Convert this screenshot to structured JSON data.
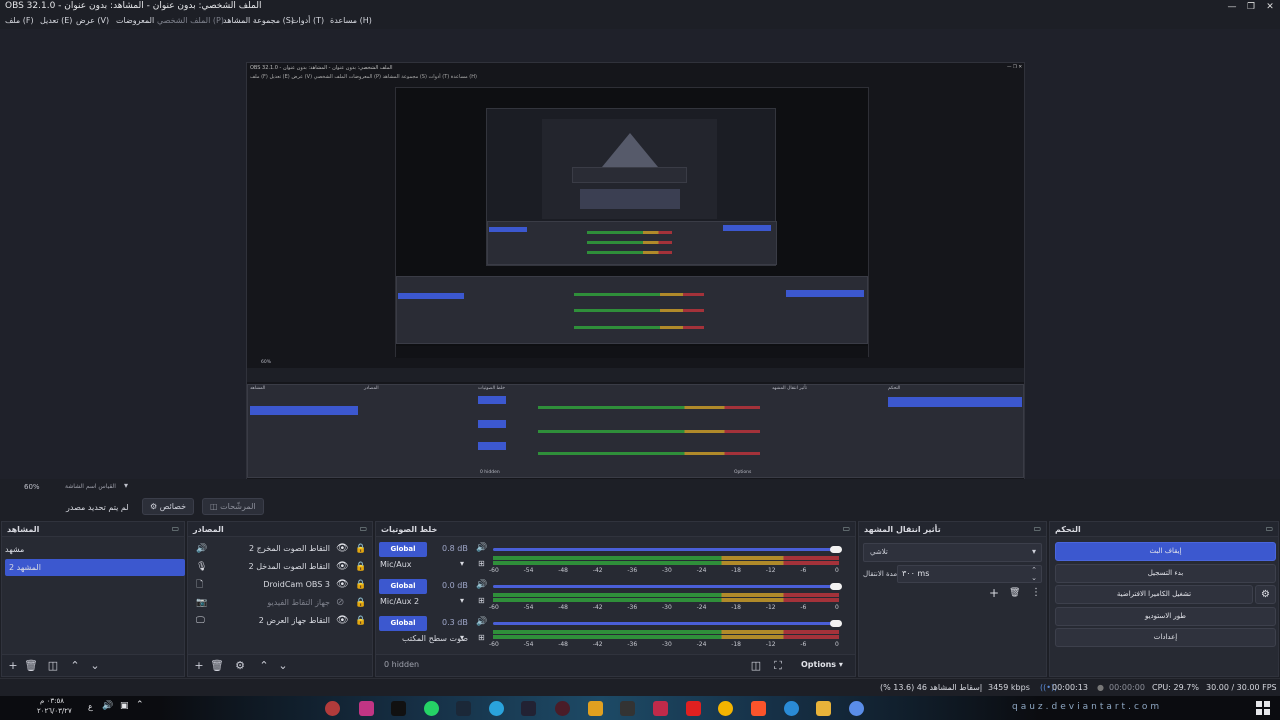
{
  "window": {
    "title": "OBS 32.1.0 - الملف الشخصي: بدون عنوان - المشاهد: بدون عنوان",
    "minimize": "—",
    "maximize": "❐",
    "close": "✕"
  },
  "menu": [
    {
      "label": "ملف (F)",
      "key": "file"
    },
    {
      "label": "تعديل (E)",
      "key": "edit"
    },
    {
      "label": "عرض (V)",
      "key": "view"
    },
    {
      "label": "المعروضات",
      "key": "docks"
    },
    {
      "label": "الملف الشخصي (P)",
      "key": "profile"
    },
    {
      "label": "مجموعة المشاهد (S)",
      "key": "scenes"
    },
    {
      "label": "أدوات (T)",
      "key": "tools"
    },
    {
      "label": "مساعدة (H)",
      "key": "help"
    }
  ],
  "nested": {
    "title": "OBS 32.1.0 - الملف الشخصي: بدون عنوان - المشاهد: بدون عنوان",
    "menu": "ملف (F)  تعديل (E)  عرض (V)  المعروضات  الملف الشخصي (P)  مجموعة المشاهد (S)  أدوات (T)  مساعدة (H)",
    "zoom": "60%",
    "docks": {
      "scenes": "المشاهد",
      "sources": "المصادر",
      "mixer": "خلط الصوتيات",
      "transitions": "تأثير انتقال المشهد",
      "controls": "التحكم"
    },
    "hidden": "0 hidden",
    "options": "Options"
  },
  "toolbar_row": {
    "zoom": "60%",
    "preview_label": "القياس اسم الشاشة",
    "no_source": "لم يتم تحديد مصدر",
    "properties": "خصائص",
    "filters": "المرشّحات"
  },
  "scenes": {
    "title": "المشاهد",
    "items": [
      "مشهد",
      "المشهد 2"
    ],
    "selected": 1
  },
  "sources": {
    "title": "المصادر",
    "items": [
      {
        "name": "التقاط الصوت المخرج 2",
        "icon": "speaker-icon",
        "dim": false,
        "visible": true
      },
      {
        "name": "التقاط الصوت المدخل 2",
        "icon": "mic-icon",
        "dim": false,
        "visible": true
      },
      {
        "name": "DroidCam OBS 3",
        "icon": "file-icon",
        "dim": false,
        "visible": true
      },
      {
        "name": "جهاز التقاط الفيديو",
        "icon": "camera-icon",
        "dim": true,
        "visible": false
      },
      {
        "name": "التقاط جهاز العرض 2",
        "icon": "monitor-icon",
        "dim": false,
        "visible": true
      }
    ]
  },
  "mixer": {
    "title": "خلط الصوتيات",
    "tracks": [
      {
        "badge": "Global",
        "db": "0.8 dB",
        "level": 0.99,
        "source": "Mic/Aux",
        "dropdown": true
      },
      {
        "badge": "Global",
        "db": "0.0 dB",
        "level": 0.99,
        "source": "Mic/Aux 2",
        "dropdown": true
      },
      {
        "badge": "Global",
        "db": "0.3 dB",
        "level": 0.99,
        "source": "صوت سطح المكتب",
        "dropdown": true
      }
    ],
    "ticks": [
      "-60",
      "-54",
      "-48",
      "-42",
      "-36",
      "-30",
      "-24",
      "-18",
      "-12",
      "-6",
      "0"
    ],
    "hidden": "0 hidden",
    "options": "Options"
  },
  "transitions": {
    "title": "تأثير انتقال المشهد",
    "type": "تلاشي",
    "duration_label": "مدة الانتقال",
    "duration_value": "٣٠٠ ms"
  },
  "controls": {
    "title": "التحكم",
    "buttons": [
      "إيقاف البث",
      "بدء التسجيل",
      "تشغيل الكاميرا الافتراضية",
      "طور الاستوديو",
      "إعدادات"
    ]
  },
  "status": {
    "dropped": "إسقاط المشاهد 46 (13.6 %)",
    "bitrate": "3459 kbps",
    "stream_time": "00:00:13",
    "rec_time": "00:00:00",
    "cpu": "CPU: 29.7%",
    "fps": "30.00 / 30.00 FPS"
  },
  "taskbar": {
    "time": "٠٣:٥٨ م",
    "date": "٢٠٢٦/٠٣/٢٧",
    "lang": "ع",
    "watermark": "qauz.deviantart.com"
  },
  "colors": {
    "accent": "#3c58cf",
    "bg": "#1d1f26",
    "panel": "#272a33",
    "meter_green": "#2f8f3a",
    "meter_yellow": "#b08a2a",
    "meter_red": "#a4323a"
  }
}
